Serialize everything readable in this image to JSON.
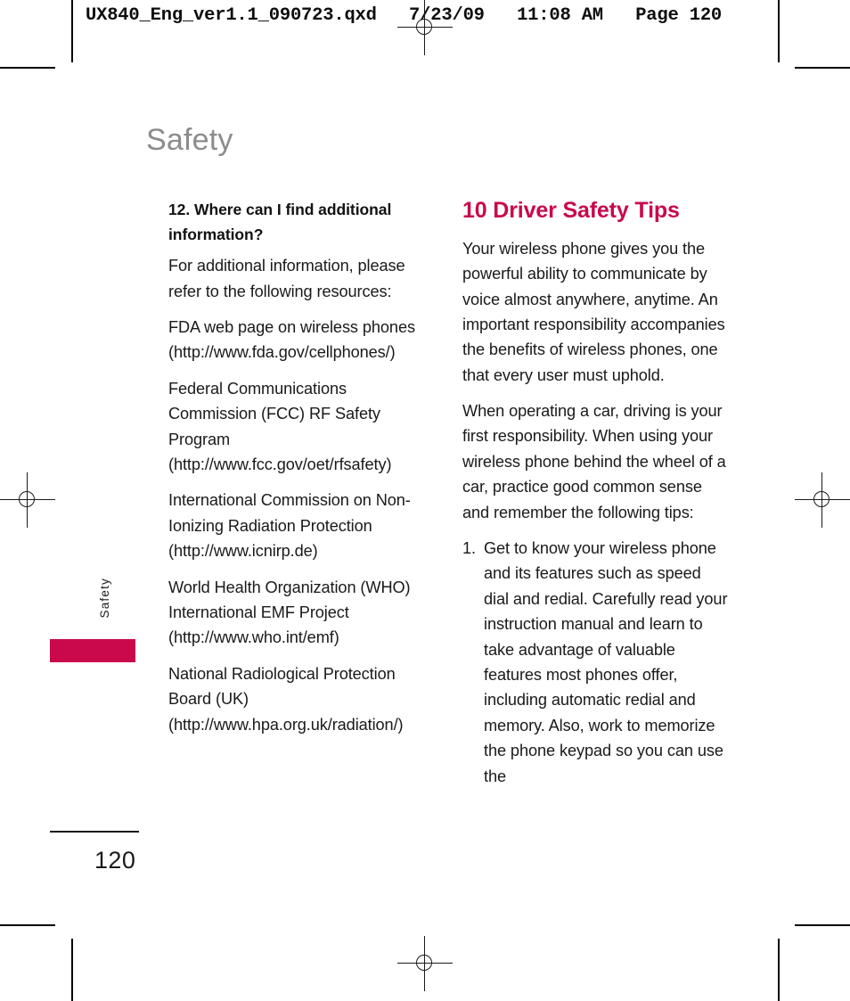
{
  "proof": {
    "header_slug": "UX840_Eng_ver1.1_090723.qxd   7/23/09   11:08 AM   Page 120"
  },
  "chapter": {
    "title": "Safety",
    "side_tab_label": "Safety",
    "accent_color": "#C9094C",
    "title_color": "#8c8c8c"
  },
  "footer": {
    "page_number": "120"
  },
  "left_column": {
    "sub_heading": "12. Where can I find additional information?",
    "paragraphs": [
      "For additional information, please refer to the following resources:",
      "FDA web page on wireless phones (http://www.fda.gov/cellphones/)",
      "Federal Communications Commission (FCC) RF Safety Program (http://www.fcc.gov/oet/rfsafety)",
      "International Commission on Non-Ionizing Radiation Protection (http://www.icnirp.de)",
      "World Health Organization (WHO) International EMF Project (http://www.who.int/emf)",
      "National Radiological Protection Board (UK) (http://www.hpa.org.uk/radiation/)"
    ]
  },
  "right_column": {
    "section_heading": "10 Driver Safety Tips",
    "paragraphs": [
      "Your wireless phone gives you the powerful ability to communicate by voice almost anywhere, anytime. An important responsibility accompanies the benefits of wireless phones, one that every user must uphold.",
      "When operating a car, driving is your first responsibility. When using your wireless phone behind the wheel of a car, practice good common sense and remember the following tips:"
    ],
    "tips": [
      {
        "number": "1.",
        "text": "Get to know your wireless phone and its features such as speed dial and redial. Carefully read your instruction manual and learn to take advantage of valuable features most phones offer, including automatic redial and memory. Also, work to memorize the phone keypad so you can use the"
      }
    ]
  }
}
